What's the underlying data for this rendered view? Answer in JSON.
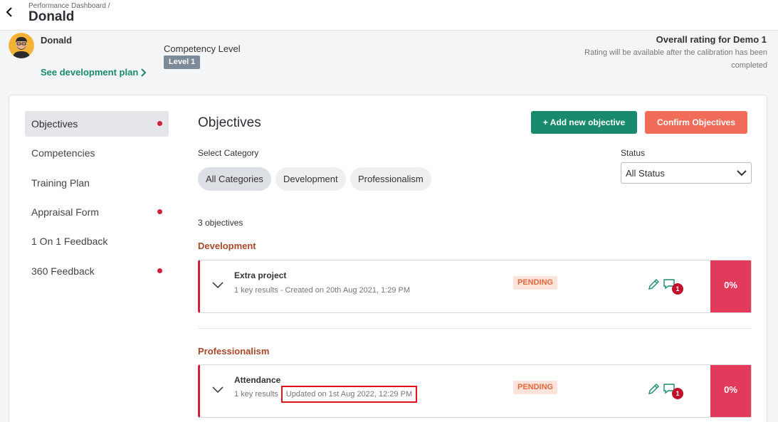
{
  "header": {
    "breadcrumb": "Performance Dashboard /",
    "title": "Donald"
  },
  "profile": {
    "name": "Donald",
    "dev_plan_link": "See development plan",
    "competency_label": "Competency Level",
    "level_badge": "Level 1",
    "overall_rating": "Overall rating for Demo 1",
    "rating_note": "Rating will be available after the calibration has been completed"
  },
  "sidebar": {
    "items": [
      {
        "label": "Objectives",
        "active": true,
        "dot": true
      },
      {
        "label": "Competencies",
        "active": false,
        "dot": false
      },
      {
        "label": "Training Plan",
        "active": false,
        "dot": false
      },
      {
        "label": "Appraisal Form",
        "active": false,
        "dot": true
      },
      {
        "label": "1 On 1 Feedback",
        "active": false,
        "dot": false
      },
      {
        "label": "360 Feedback",
        "active": false,
        "dot": true
      }
    ]
  },
  "main": {
    "heading": "Objectives",
    "add_button": "+ Add new objective",
    "confirm_button": "Confirm Objectives",
    "select_category_label": "Select Category",
    "categories": [
      "All Categories",
      "Development",
      "Professionalism"
    ],
    "status_label": "Status",
    "status_value": "All Status",
    "count_text": "3 objectives",
    "groups": [
      {
        "title": "Development",
        "objectives": [
          {
            "name": "Extra project",
            "meta": "1 key results - Created on 20th Aug 2021, 1:29 PM",
            "updated": "",
            "status": "PENDING",
            "comments": "1",
            "progress": "0%"
          }
        ]
      },
      {
        "title": "Professionalism",
        "objectives": [
          {
            "name": "Attendance",
            "meta": "1 key results",
            "updated": "Updated on 1st Aug 2022, 12:29 PM",
            "status": "PENDING",
            "comments": "1",
            "progress": "0%"
          }
        ]
      }
    ]
  },
  "colors": {
    "brand_green": "#1a8a6e",
    "confirm_orange": "#f26c5a",
    "alert_red": "#d0213b",
    "progress_pink": "#e23a5a",
    "group_title": "#a6492a"
  }
}
